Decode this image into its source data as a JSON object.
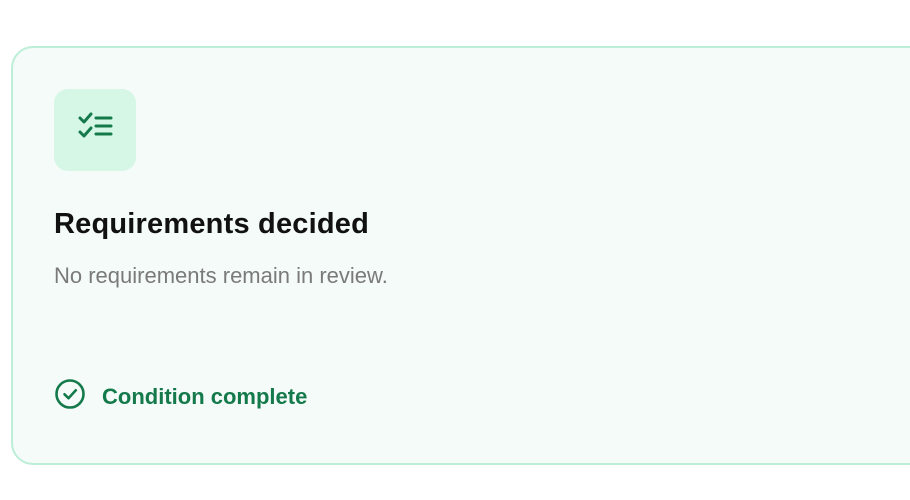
{
  "card": {
    "icon": "checklist-icon",
    "title": "Requirements decided",
    "subtitle": "No requirements remain in review.",
    "status": {
      "icon": "check-circle-icon",
      "label": "Condition complete"
    }
  },
  "colors": {
    "card_background": "#f4fbf8",
    "card_border": "#bdeed8",
    "icon_tile_background": "#d6f7e6",
    "accent_green": "#157a4b",
    "title_text": "#111111",
    "subtitle_text": "#7a7a7a"
  }
}
